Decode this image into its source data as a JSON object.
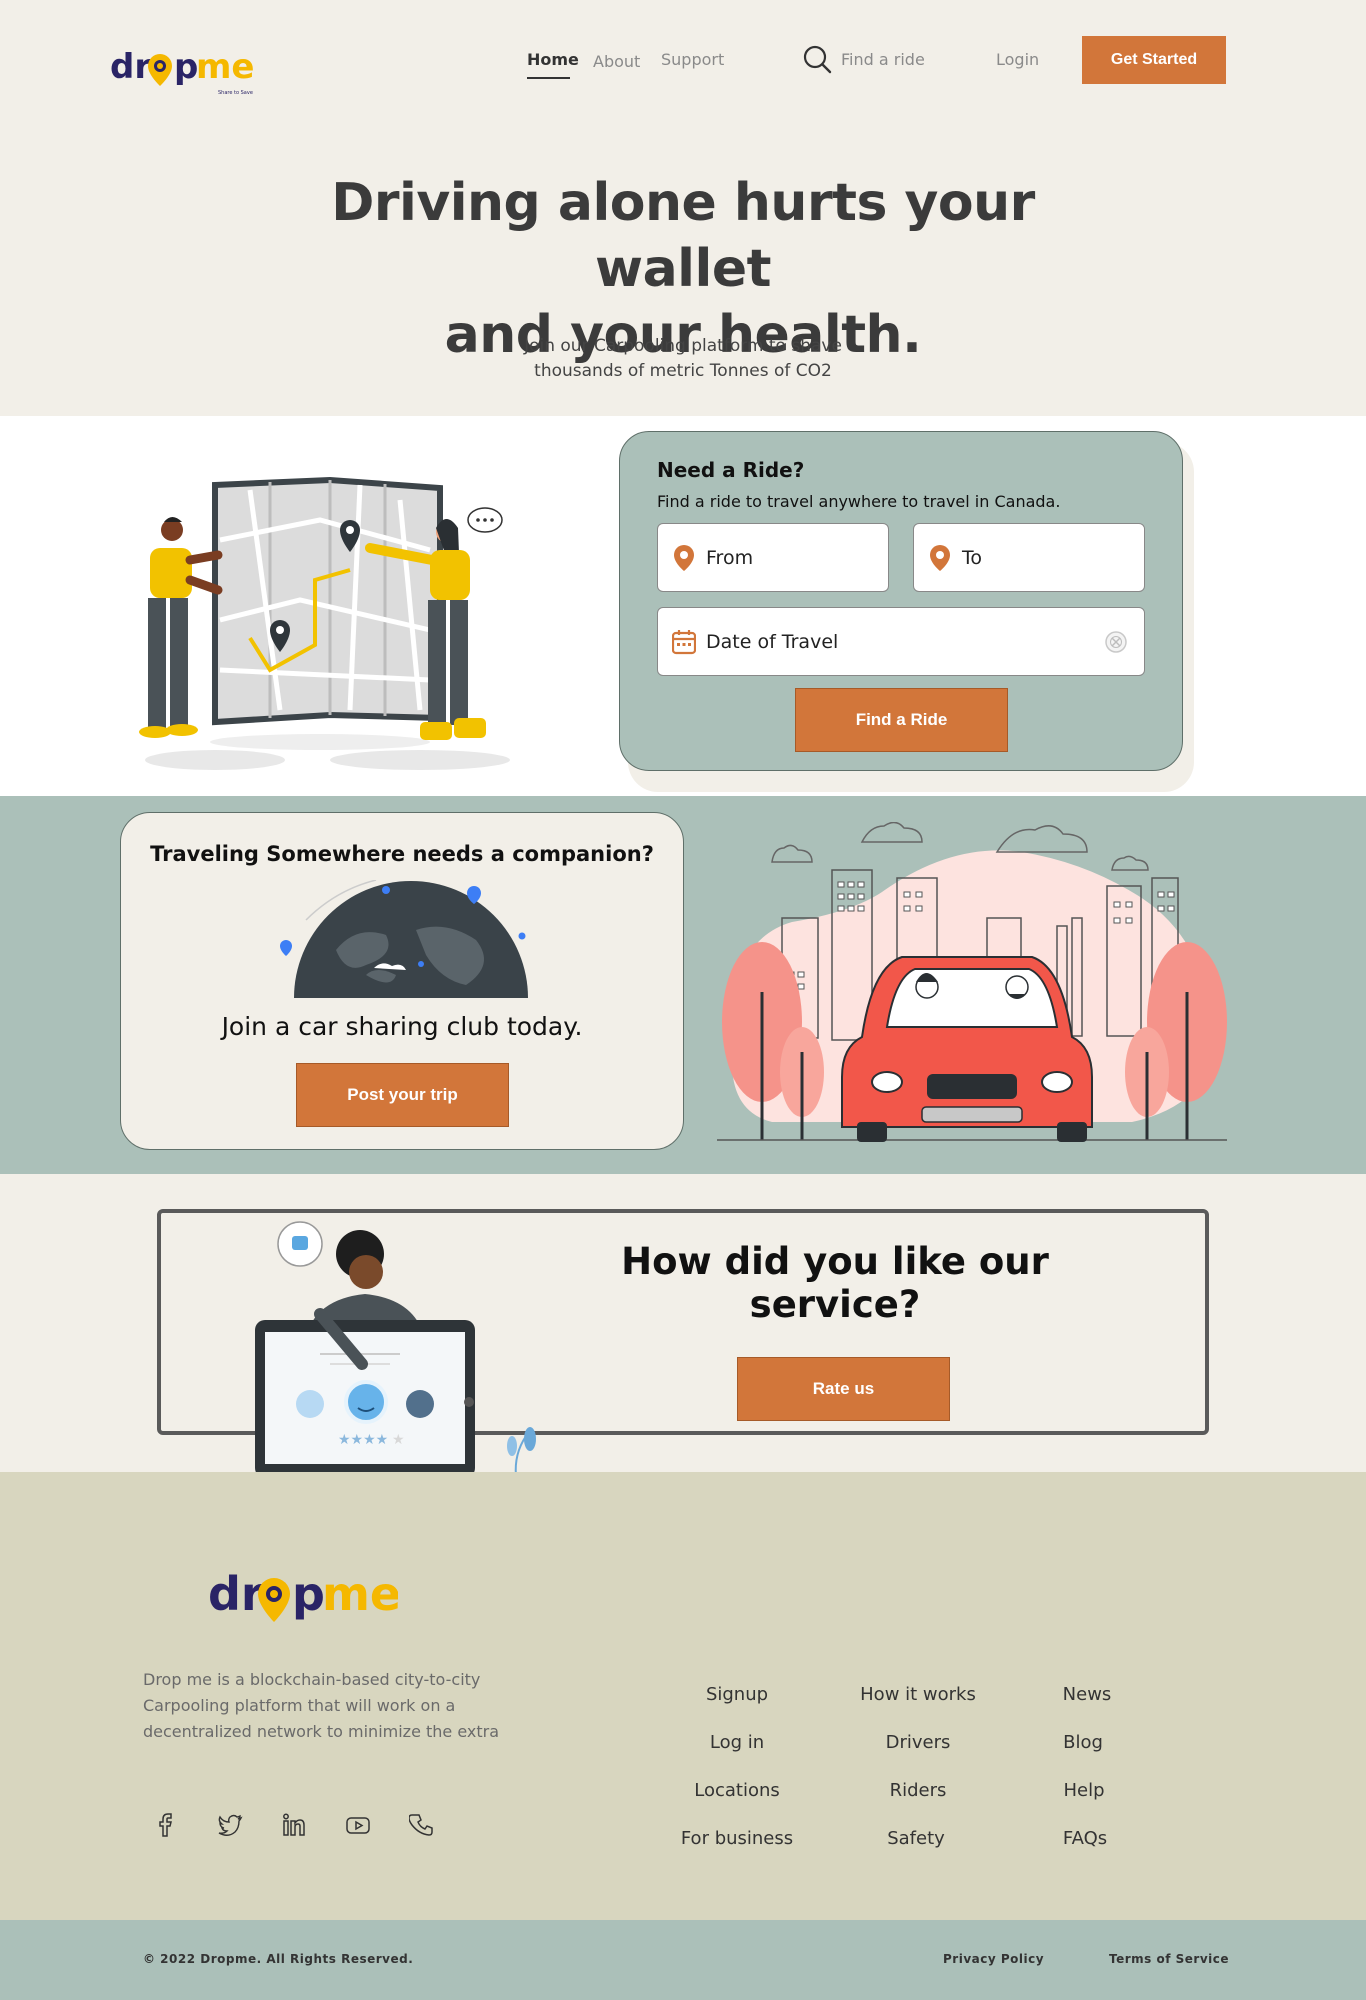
{
  "brand": {
    "name_part1": "dr",
    "name_part2": "p",
    "name_part3": "me",
    "tagline": "Share to Save",
    "accent": "#d2763a",
    "sage": "#abc0b9",
    "cream": "#f2efe8",
    "footer_bg": "#d8d6bf"
  },
  "nav": {
    "items": [
      "Home",
      "About",
      "Support"
    ],
    "active": "Home",
    "search_label": "Find a ride",
    "login": "Login",
    "cta": "Get Started"
  },
  "hero": {
    "title_line1": "Driving alone hurts your wallet",
    "title_line2": "and your health.",
    "subtitle_line1": "Join our Carpooling platform to shave",
    "subtitle_line2": "thousands of metric Tonnes of CO2"
  },
  "ride_form": {
    "title": "Need a Ride?",
    "subtitle": "Find a ride to travel anywhere to travel in Canada.",
    "from_placeholder": "From",
    "to_placeholder": "To",
    "date_placeholder": "Date of Travel",
    "submit": "Find a Ride"
  },
  "companion": {
    "title": "Traveling Somewhere needs a companion?",
    "subtitle": "Join a car sharing club today.",
    "cta": "Post your trip"
  },
  "rating": {
    "title": "How did you like our service?",
    "cta": "Rate us"
  },
  "footer": {
    "description_line1": "Drop me is a blockchain-based city-to-city",
    "description_line2": "Carpooling platform that will work on a",
    "description_line3": "decentralized network to minimize the extra",
    "social_icons": [
      "facebook-icon",
      "twitter-icon",
      "linkedin-icon",
      "youtube-icon",
      "phone-icon"
    ],
    "col1": [
      "Signup",
      "Log in",
      "Locations",
      "For business"
    ],
    "col2": [
      "How it works",
      "Drivers",
      "Riders",
      "Safety"
    ],
    "col3": [
      "News",
      "Blog",
      "Help",
      "FAQs"
    ],
    "copyright": "© 2022 Dropme.  All Rights Reserved.",
    "privacy": "Privacy Policy",
    "terms": "Terms of Service"
  }
}
